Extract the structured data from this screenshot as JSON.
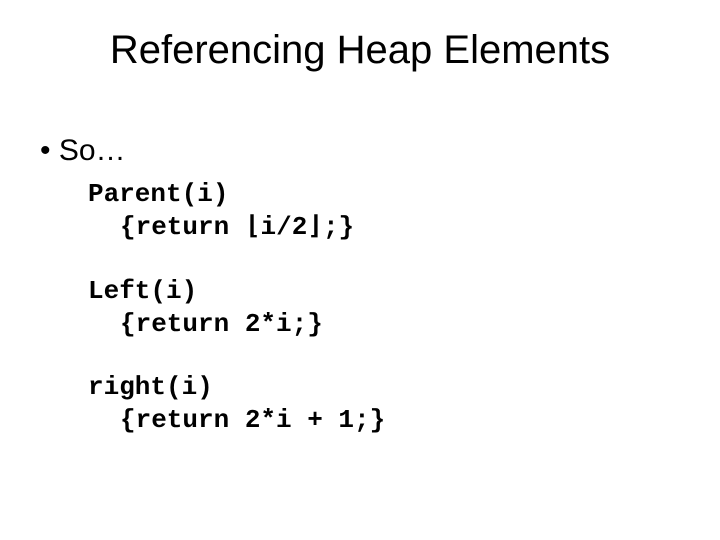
{
  "title": "Referencing Heap Elements",
  "bullet1": "So…",
  "code": {
    "parent": {
      "sig": "Parent(i)",
      "ret_prefix": "{return ",
      "floor_l": "⌊",
      "expr": "i/2",
      "floor_r": "⌋",
      "ret_suffix": ";}"
    },
    "left": {
      "sig": "Left(i)",
      "ret": "{return 2*i;}"
    },
    "right": {
      "sig": "right(i)",
      "ret": "{return 2*i + 1;}"
    }
  }
}
